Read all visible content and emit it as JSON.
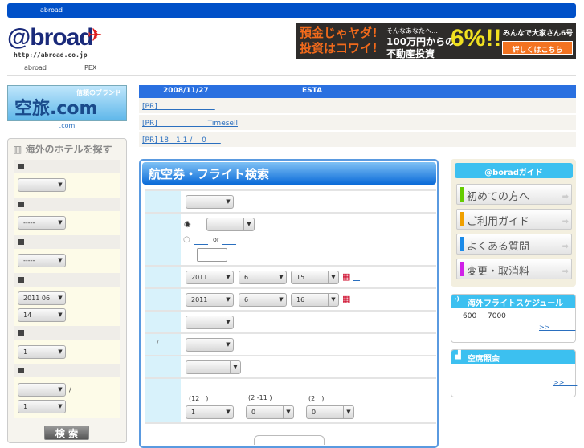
{
  "topbar": {
    "text": "abroad"
  },
  "logo": {
    "text": "@broad",
    "url": "http://abroad.co.jp"
  },
  "subnav": {
    "left": "abroad",
    "right": "PEX"
  },
  "ad": {
    "line1": "預金じゃヤダ!",
    "line2": "投資はコワイ!",
    "sub1": "そんなあなたへ…",
    "sub2": "100万円からの",
    "sub3": "不動産投資",
    "rate": "6%!!",
    "brand": "みんなで大家さん6号",
    "button": "詳しくはこちら"
  },
  "sora": {
    "logo": "空旅.com",
    "tag": "信頼のブランド",
    "caption": ".com"
  },
  "hotel": {
    "title": "海外のホテルを探す",
    "sel_country": "",
    "sel_city": "-----",
    "sel_area": "-----",
    "checkin_month": "2011 06",
    "checkin_day": "14",
    "nights": "1",
    "room_type": "",
    "rooms": "1",
    "slash": "/",
    "search": "検 索"
  },
  "news": {
    "date": "2008/11/27",
    "esta": "ESTA",
    "links": [
      "[PR]",
      "[PR]　　　　　　　Timesell",
      "[PR]  18　1 1 /　 0　　"
    ]
  },
  "flight": {
    "title": "航空券・フライト検索",
    "or": "or",
    "dep_year": "2011",
    "dep_month": "6",
    "dep_day": "15",
    "ret_year": "2011",
    "ret_month": "6",
    "ret_day": "16",
    "slash": "/",
    "adult_label": "(12　)",
    "child_label": "(2 -11 )",
    "infant_label": "(2　)",
    "adults": "1",
    "children": "0",
    "infants": "0"
  },
  "guide": {
    "title": "@boradガイド",
    "items": [
      {
        "label": "初めての方へ",
        "color": "#66cc00"
      },
      {
        "label": "ご利用ガイド",
        "color": "#f0a000"
      },
      {
        "label": "よくある質問",
        "color": "#1a8ae8"
      },
      {
        "label": "変更・取消料",
        "color": "#d020e8"
      }
    ]
  },
  "schedule": {
    "title": "海外フライトスケジュール",
    "n1": "600",
    "n2": "7000",
    "more": ">>　　　　"
  },
  "seat": {
    "title": "空席照会",
    "more": ">>　　"
  }
}
